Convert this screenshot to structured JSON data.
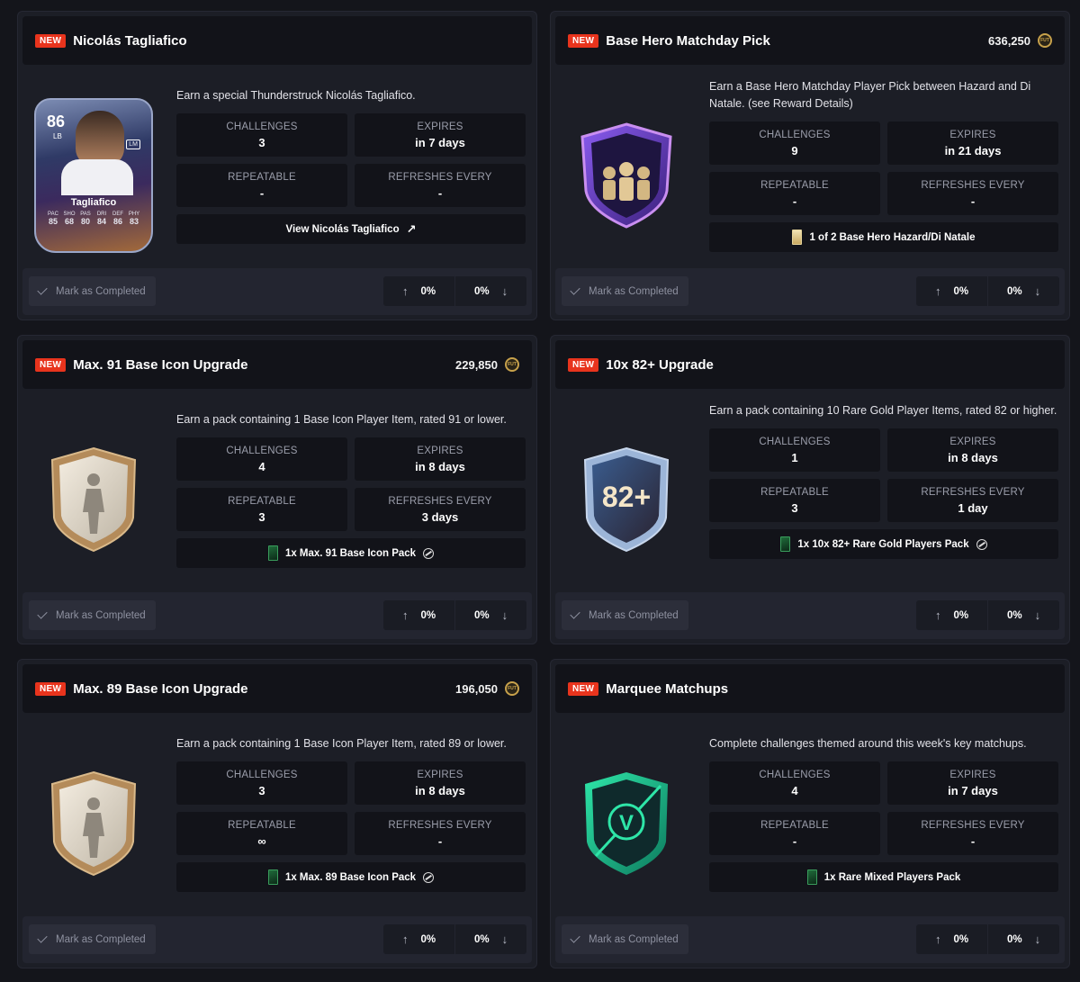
{
  "common": {
    "new_badge": "NEW",
    "mark_completed": "Mark as Completed",
    "coin_text": "FUT",
    "labels": {
      "challenges": "CHALLENGES",
      "expires": "EXPIRES",
      "repeatable": "REPEATABLE",
      "refreshes": "REFRESHES EVERY"
    }
  },
  "cards": [
    {
      "title": "Nicolás Tagliafico",
      "price": "",
      "description": "Earn a special Thunderstruck Nicolás Tagliafico.",
      "challenges": "3",
      "expires": "in 7 days",
      "repeatable": "-",
      "refreshes": "-",
      "reward": "View Nicolás Tagliafico",
      "reward_suffix": "↗",
      "vote_up": "0%",
      "vote_down": "0%",
      "image": "player-card",
      "player": {
        "rating": "86",
        "position": "LB",
        "alt_position": "LM",
        "name": "Tagliafico",
        "stat_labels": [
          "PAC",
          "SHO",
          "PAS",
          "DRI",
          "DEF",
          "PHY"
        ],
        "stat_values": [
          "85",
          "68",
          "80",
          "84",
          "86",
          "83"
        ]
      }
    },
    {
      "title": "Base Hero Matchday Pick",
      "price": "636,250",
      "description": "Earn a Base Hero Matchday Player Pick between Hazard and Di Natale. (see Reward Details)",
      "challenges": "9",
      "expires": "in 21 days",
      "repeatable": "-",
      "refreshes": "-",
      "reward": "1 of 2 Base Hero Hazard/Di Natale",
      "vote_up": "0%",
      "vote_down": "0%",
      "image": "hero-badge"
    },
    {
      "title": "Max. 91 Base Icon Upgrade",
      "price": "229,850",
      "description": "Earn a pack containing 1 Base Icon Player Item, rated 91 or lower.",
      "challenges": "4",
      "expires": "in 8 days",
      "repeatable": "3",
      "refreshes": "3 days",
      "reward": "1x Max. 91 Base Icon Pack",
      "vote_up": "0%",
      "vote_down": "0%",
      "image": "icon-badge"
    },
    {
      "title": "10x 82+ Upgrade",
      "price": "",
      "description": "Earn a pack containing 10 Rare Gold Player Items, rated 82 or higher.",
      "challenges": "1",
      "expires": "in 8 days",
      "repeatable": "3",
      "refreshes": "1 day",
      "reward": "1x 10x 82+ Rare Gold Players Pack",
      "vote_up": "0%",
      "vote_down": "0%",
      "image": "82-badge",
      "badge_text": "82+"
    },
    {
      "title": "Max. 89 Base Icon Upgrade",
      "price": "196,050",
      "description": "Earn a pack containing 1 Base Icon Player Item, rated 89 or lower.",
      "challenges": "3",
      "expires": "in 8 days",
      "repeatable": "∞",
      "refreshes": "-",
      "reward": "1x Max. 89 Base Icon Pack",
      "vote_up": "0%",
      "vote_down": "0%",
      "image": "icon-badge"
    },
    {
      "title": "Marquee Matchups",
      "price": "",
      "description": "Complete challenges themed around this week's key matchups.",
      "challenges": "4",
      "expires": "in 7 days",
      "repeatable": "-",
      "refreshes": "-",
      "reward": "1x Rare Mixed Players Pack",
      "vote_up": "0%",
      "vote_down": "0%",
      "image": "v-badge",
      "badge_text": "V"
    }
  ],
  "colors": {
    "page_bg": "#14151b",
    "card_bg": "#1c1e26",
    "new_badge": "#e8341d",
    "coin": "#c7a14b",
    "muted_text": "#9b9eab"
  }
}
